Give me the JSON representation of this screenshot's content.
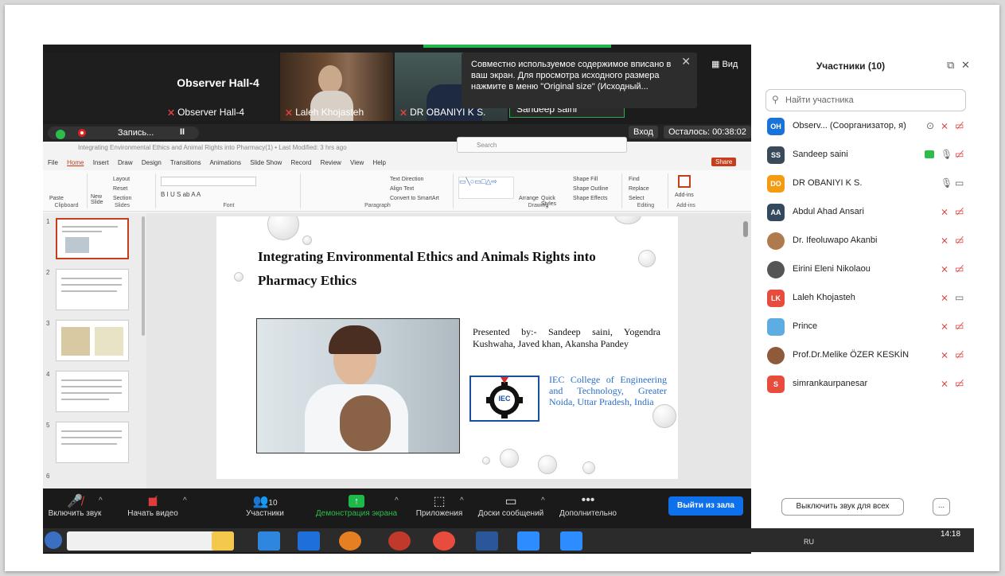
{
  "meeting": {
    "observer_tile_title": "Observer Hall-4",
    "tiles": [
      {
        "name": "Observer Hall-4"
      },
      {
        "name": "Laleh Khojasteh"
      },
      {
        "name": "DR OBANIYI K S."
      },
      {
        "name": "Sandeep saini"
      }
    ],
    "tooltip": "Совместно используемое содержимое вписано в ваш экран. Для просмотра исходного размера нажмите в меню \"Original size\" (Исходный...",
    "view_label": "Вид",
    "recording_label": "Запись...",
    "pause_icon": "II",
    "enter_label": "Вход",
    "remaining_label": "Осталось: 00:38:02"
  },
  "ppt": {
    "window_title": "Integrating Environmental Ethics and Animal Rights into Pharmacy(1) • Last Modified: 3 hrs ago",
    "search_placeholder": "Search",
    "tabs": [
      "File",
      "Home",
      "Insert",
      "Draw",
      "Design",
      "Transitions",
      "Animations",
      "Slide Show",
      "Record",
      "Review",
      "View",
      "Help"
    ],
    "share_label": "Share",
    "groups": [
      "Clipboard",
      "Slides",
      "Font",
      "Paragraph",
      "Drawing",
      "Editing",
      "Add-ins"
    ],
    "ribbon_items": {
      "paste": "Paste",
      "new_slide": "New Slide",
      "layout": "Layout",
      "reset": "Reset",
      "section": "Section",
      "text_direction": "Text Direction",
      "align_text": "Align Text",
      "smartart": "Convert to SmartArt",
      "arrange": "Arrange",
      "quick_styles": "Quick Styles",
      "shape_fill": "Shape Fill",
      "shape_outline": "Shape Outline",
      "shape_effects": "Shape Effects",
      "find": "Find",
      "replace": "Replace",
      "select": "Select",
      "addins": "Add-ins"
    },
    "slide_numbers": [
      "1",
      "2",
      "3",
      "4",
      "5",
      "6"
    ],
    "slide": {
      "title": "Integrating Environmental Ethics and Animals Rights into Pharmacy Ethics",
      "presented_by": "Presented by:- Sandeep saini, Yogendra Kushwaha, Javed khan, Akansha Pandey",
      "college": "IEC College of Engineering and Technology, Greater Noida, Uttar Pradesh, India",
      "logo_text": "IEC"
    }
  },
  "toolbar": {
    "mute": "Включить звук",
    "video": "Начать видео",
    "participants": "Участники",
    "participants_count": "10",
    "share": "Демонстрация экрана",
    "apps": "Приложения",
    "whiteboards": "Доски сообщений",
    "more": "Дополнительно",
    "leave": "Выйти из зала"
  },
  "panel": {
    "title": "Участники (10)",
    "search_placeholder": "Найти участника",
    "participants": [
      {
        "initials": "OH",
        "name": "Observ... (Соорганизатор, я)",
        "color": "#1a73d6"
      },
      {
        "initials": "SS",
        "name": "Sandeep saini",
        "color": "#3a4a5a"
      },
      {
        "initials": "DO",
        "name": "DR OBANIYI K S.",
        "color": "#f39c12"
      },
      {
        "initials": "AA",
        "name": "Abdul Ahad Ansari",
        "color": "#34495e"
      },
      {
        "initials": "",
        "name": "Dr. Ifeoluwapo Akanbi",
        "color": "#b07a4f"
      },
      {
        "initials": "",
        "name": "Eirini Eleni Nikolaou",
        "color": "#555555"
      },
      {
        "initials": "LK",
        "name": "Laleh Khojasteh",
        "color": "#e74c3c"
      },
      {
        "initials": "",
        "name": "Prince",
        "color": "#5dade2"
      },
      {
        "initials": "",
        "name": "Prof.Dr.Melike ÖZER KESKİN",
        "color": "#8e5a3a"
      },
      {
        "initials": "S",
        "name": "simrankaurpanesar",
        "color": "#e74c3c"
      }
    ],
    "mute_all": "Выключить звук для всех",
    "more": "..."
  },
  "taskbar": {
    "lang": "RU",
    "time": "14:18"
  }
}
